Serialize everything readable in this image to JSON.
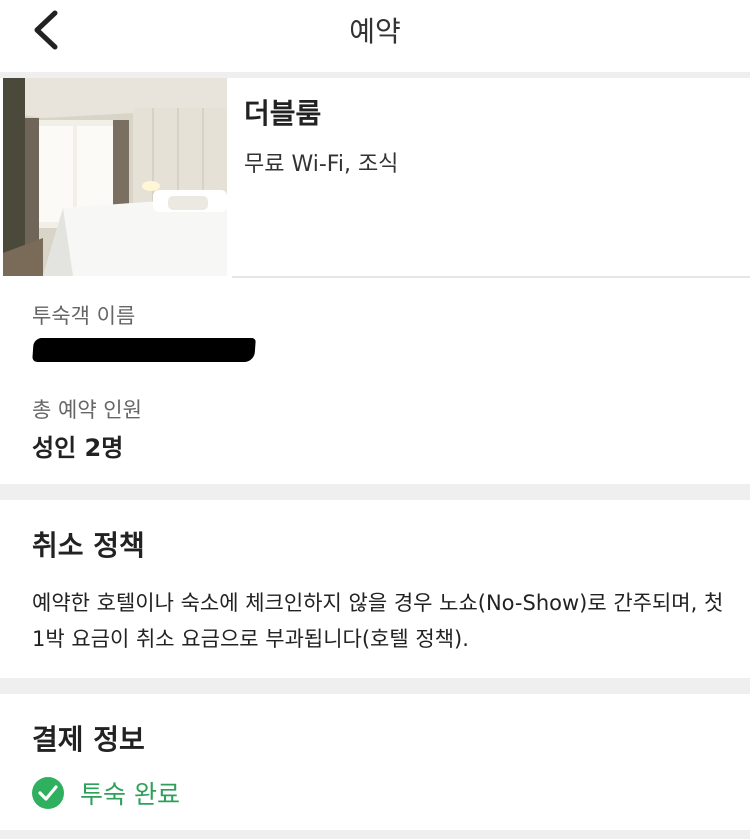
{
  "header": {
    "title": "예약"
  },
  "icons": {
    "back": "chevron-left-icon",
    "status": "check-circle-icon"
  },
  "room": {
    "name": "더블룸",
    "amenities": "무료 Wi-Fi, 조식"
  },
  "guest": {
    "name_label": "투숙객 이름",
    "count_label": "총 예약 인원",
    "count_value": "성인 2명"
  },
  "cancellation": {
    "title": "취소 정책",
    "text": "예약한 호텔이나 숙소에 체크인하지 않을 경우 노쇼(No-Show)로 간주되며, 첫 1박 요금이 취소 요금으로 부과됩니다(호텔 정책)."
  },
  "payment": {
    "title": "결제 정보",
    "status": "투숙 완료"
  },
  "colors": {
    "accent": "#2fb05f",
    "divider": "#efefef"
  }
}
